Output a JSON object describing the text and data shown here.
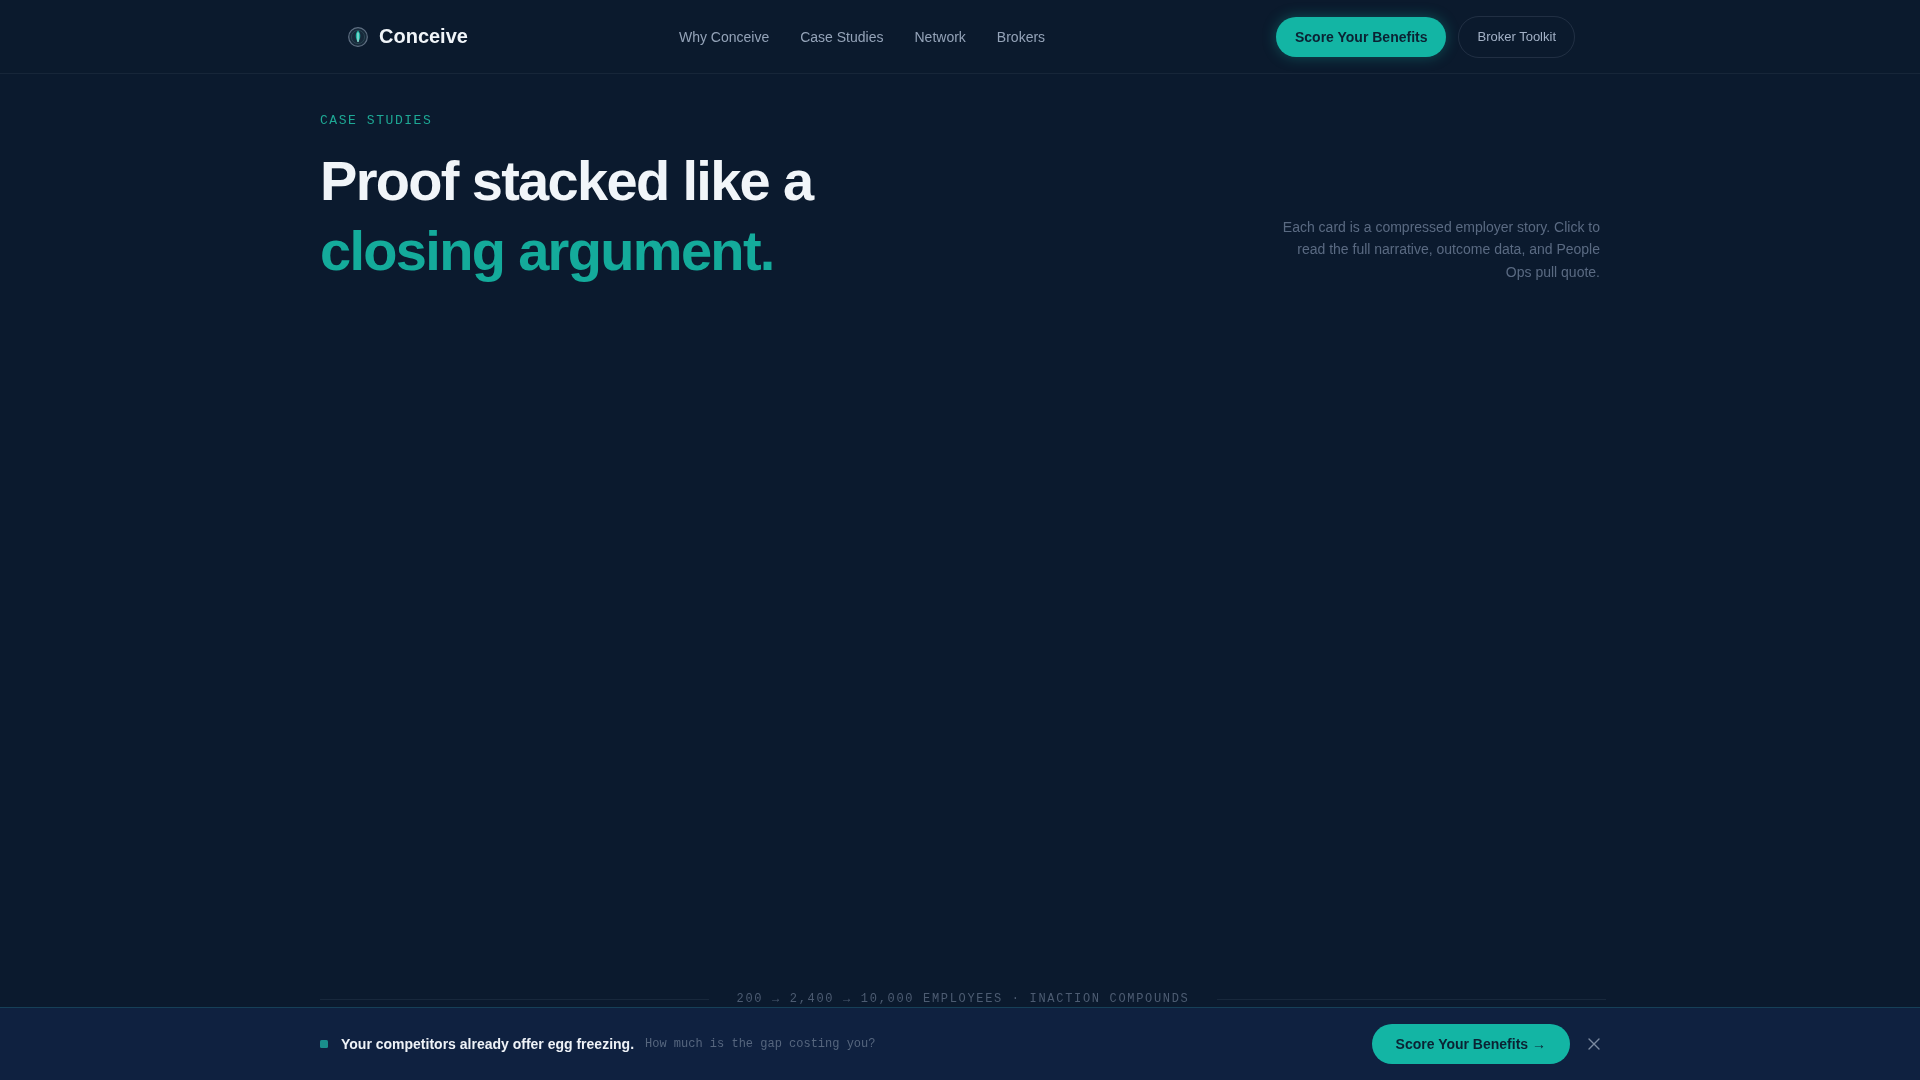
{
  "header": {
    "brand": "Conceive",
    "nav": [
      "Why Conceive",
      "Case Studies",
      "Network",
      "Brokers"
    ],
    "actions": [
      {
        "label": "Score Your Benefits",
        "kind": "primary"
      },
      {
        "label": "Broker Toolkit",
        "kind": "outline"
      }
    ]
  },
  "hero": {
    "eyebrow": "CASE STUDIES",
    "headline": "Proof stacked like a",
    "headline_accent": "closing argument.",
    "intro": "Each card is a compressed employer story. Click to read the full narrative, outcome data, and People Ops pull quote."
  },
  "ticker": "200 → 2,400 → 10,000 EMPLOYEES · INACTION COMPOUNDS",
  "cta_bar": {
    "headline": "Your competitors already offer egg freezing.",
    "subtext": "How much is the gap costing you?",
    "button": "Score Your Benefits →"
  }
}
